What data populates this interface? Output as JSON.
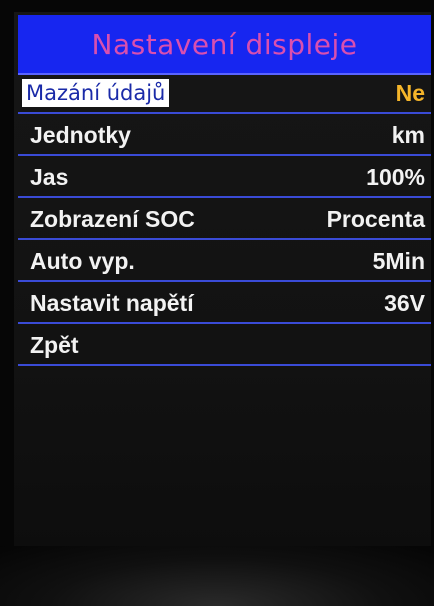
{
  "header": {
    "title": "Nastavení displeje"
  },
  "menu": {
    "items": [
      {
        "label": "Mazání údajů",
        "value": "Ne",
        "selected": true
      },
      {
        "label": "Jednotky",
        "value": "km"
      },
      {
        "label": "Jas",
        "value": "100%"
      },
      {
        "label": "Zobrazení SOC",
        "value": "Procenta"
      },
      {
        "label": "Auto vyp.",
        "value": "5Min"
      },
      {
        "label": "Nastavit napětí",
        "value": "36V"
      },
      {
        "label": "Zpět",
        "value": ""
      }
    ]
  },
  "colors": {
    "title_bg": "#1726f0",
    "title_text": "#d94fb0",
    "divider": "#3a4bd6",
    "selected_value": "#f5b52a"
  }
}
